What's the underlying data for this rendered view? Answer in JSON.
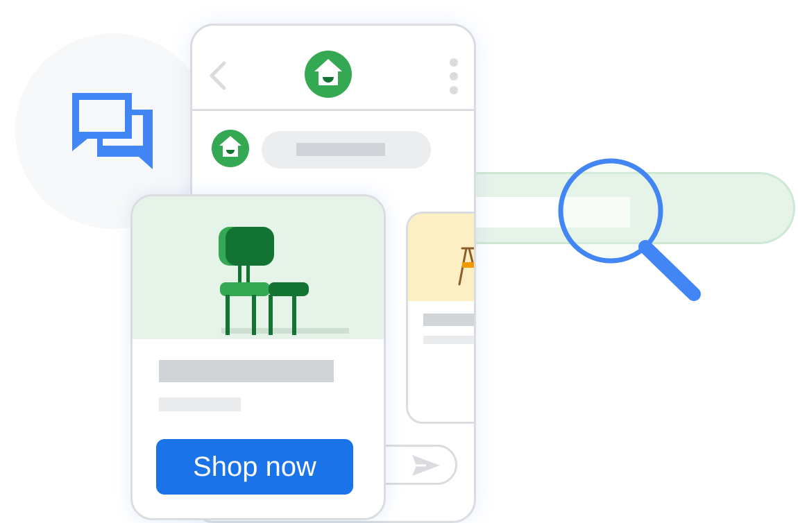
{
  "colors": {
    "chat_icon_blue": "#4285f4",
    "brand_green": "#34a853",
    "brand_dark_green": "#137333",
    "button_blue": "#1a73e8",
    "search_green_bg": "#e6f3e8",
    "card2_media_yellow": "#fcefc4"
  },
  "icons": {
    "chat": "chat-bubbles-icon",
    "back": "chevron-left-icon",
    "brand": "home-store-logo",
    "menu": "more-vert-icon",
    "search": "magnifier-icon",
    "send": "send-icon"
  },
  "product_card": {
    "image": "chair-illustration",
    "cta_label": "Shop now"
  },
  "secondary_card": {
    "image": "lamp-illustration"
  }
}
